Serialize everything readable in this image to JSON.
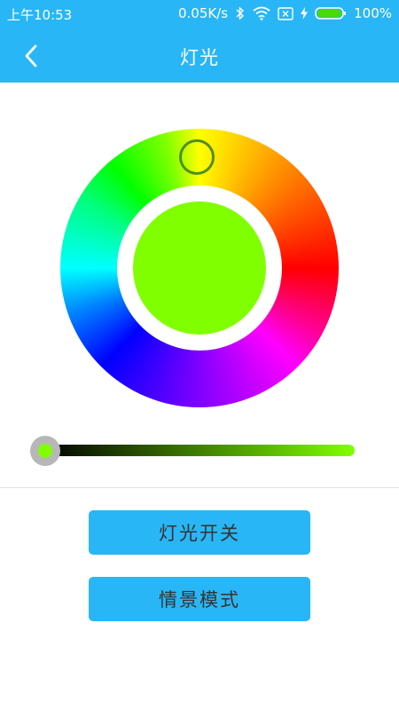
{
  "status_bar": {
    "time": "上午10:53",
    "net_speed": "0.05K/s",
    "battery": "100%",
    "icons": [
      "bluetooth-icon",
      "wifi-icon",
      "no-sim-icon",
      "charging-icon",
      "battery-icon"
    ]
  },
  "header": {
    "title": "灯光",
    "back_icon": "chevron-left-icon"
  },
  "color_picker": {
    "selected_color": "#80ff00"
  },
  "brightness": {
    "color": "#80ff00",
    "level": 0.0
  },
  "buttons": {
    "light_switch_label": "灯光开关",
    "scene_mode_label": "情景模式"
  },
  "colors": {
    "accent": "#29b6f6",
    "button_text": "#333333"
  }
}
